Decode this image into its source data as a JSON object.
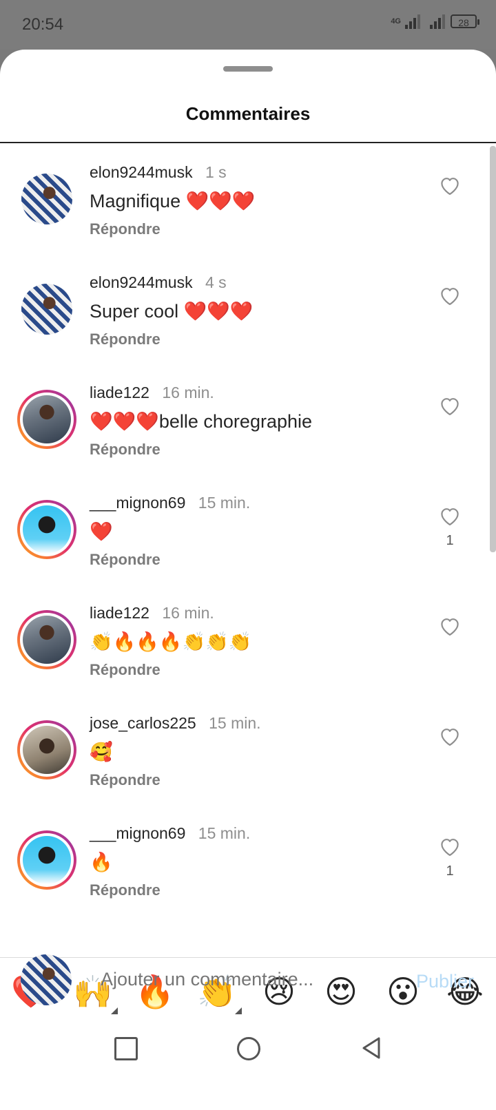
{
  "status_bar": {
    "time": "20:54",
    "network": "4G",
    "battery": "28"
  },
  "sheet": {
    "title": "Commentaires"
  },
  "reply_label": "Répondre",
  "comments": [
    {
      "username": "elon9244musk",
      "time": "1 s",
      "text": "Magnifique ❤️❤️❤️",
      "likes": "",
      "avatar": "av-musk",
      "ring": false
    },
    {
      "username": "elon9244musk",
      "time": "4 s",
      "text": "Super cool ❤️❤️❤️",
      "likes": "",
      "avatar": "av-musk",
      "ring": false
    },
    {
      "username": "liade122",
      "time": "16 min.",
      "text": "❤️❤️❤️belle choregraphie",
      "likes": "",
      "avatar": "av-liade",
      "ring": true
    },
    {
      "username": "___mignon69",
      "time": "15 min.",
      "text": "❤️",
      "likes": "1",
      "avatar": "av-mignon",
      "ring": true
    },
    {
      "username": "liade122",
      "time": "16 min.",
      "text": "👏🔥🔥🔥👏👏👏",
      "likes": "",
      "avatar": "av-liade",
      "ring": true
    },
    {
      "username": "jose_carlos225",
      "time": "15 min.",
      "text": "🥰",
      "likes": "",
      "avatar": "av-jose",
      "ring": true
    },
    {
      "username": "___mignon69",
      "time": "15 min.",
      "text": "🔥",
      "likes": "1",
      "avatar": "av-mignon",
      "ring": true
    }
  ],
  "reactions": [
    {
      "emoji": "❤️",
      "has_variants": false
    },
    {
      "emoji": "🙌",
      "has_variants": true
    },
    {
      "emoji": "🔥",
      "has_variants": false
    },
    {
      "emoji": "👏",
      "has_variants": true
    },
    {
      "emoji": "😢",
      "has_variants": false
    },
    {
      "emoji": "😍",
      "has_variants": false
    },
    {
      "emoji": "😮",
      "has_variants": false
    },
    {
      "emoji": "😂",
      "has_variants": false
    }
  ],
  "composer": {
    "placeholder": "Ajouter un commentaire...",
    "publish_label": "Publier"
  },
  "colors": {
    "accent_disabled": "#b7dbf6",
    "username": "#262626",
    "muted": "#8e8e8e"
  }
}
